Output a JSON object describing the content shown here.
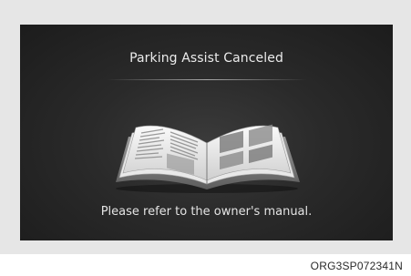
{
  "display": {
    "title": "Parking Assist Canceled",
    "message": "Please refer to the owner's manual.",
    "icon": "owner-manual-book-icon"
  },
  "figure_code": "ORG3SP072341N",
  "colors": {
    "frame": "#e6e6e6",
    "screen": "#262626",
    "text": "#ececec"
  }
}
